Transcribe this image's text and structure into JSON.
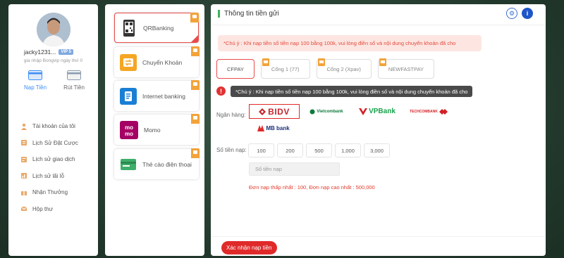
{
  "user": {
    "username": "jacky1231...",
    "vip_badge": "VIP 5",
    "join_line": "gia nhập Bongvip ngày thứ 0"
  },
  "actions": [
    {
      "label": "Nạp Tiền",
      "icon": "deposit-card-icon",
      "active": true
    },
    {
      "label": "Rút Tiền",
      "icon": "withdraw-card-icon",
      "active": false
    }
  ],
  "menu": [
    {
      "label": "Tài khoản của tôi",
      "icon": "account-icon"
    },
    {
      "label": "Lịch Sử Đặt Cược",
      "icon": "bet-history-icon"
    },
    {
      "label": "Lịch sử giao dịch",
      "icon": "transaction-history-icon"
    },
    {
      "label": "Lịch sử lãi lỗ",
      "icon": "profit-loss-icon"
    },
    {
      "label": "Nhận Thưởng",
      "icon": "reward-icon"
    },
    {
      "label": "Hộp thư",
      "icon": "mailbox-icon"
    }
  ],
  "methods": [
    {
      "label": "QRBanking",
      "icon": "qr-icon",
      "active": true
    },
    {
      "label": "Chuyển Khoản",
      "icon": "transfer-icon",
      "active": false
    },
    {
      "label": "Internet banking",
      "icon": "internet-banking-icon",
      "active": false
    },
    {
      "label": "Momo",
      "icon": "momo-icon",
      "active": false
    },
    {
      "label": "Thẻ cào điện thoại",
      "icon": "phone-card-icon",
      "active": false
    }
  ],
  "main": {
    "title": "Thông tin tiền gửi",
    "notice": "*Chú ý : Khi nạp tiền số tiền nạp 100 bằng 100k, vui lòng điền số và nội dung chuyển khoản đã cho",
    "tooltip": "*Chú ý : Khi nạp tiền số tiền nạp 100 bằng 100k, vui lòng điền số và nội dung chuyển khoản đã cho",
    "warn_glyph": "!",
    "channels": [
      "CFPAY",
      "Cổng 1 (77)",
      "Cổng 2 (Xpav)",
      "NEWFASTPAY"
    ],
    "bank_label": "Ngân hàng:",
    "banks": [
      "BIDV",
      "Vietcombank",
      "VPBank",
      "TECHCOMBANK",
      "MB bank"
    ],
    "amount_label": "Số tiền nạp:",
    "amounts": [
      "100",
      "200",
      "500",
      "1,000",
      "3,000"
    ],
    "amount_placeholder": "Số tiền nạp",
    "limits": "Đơn nạp thấp nhất : 100,  Đơn nạp cao nhất : 500,000",
    "submit_label": "Xác nhận nạp tiền"
  },
  "colors": {
    "accent_red": "#e02a2a",
    "active_blue": "#3d8df5",
    "flag_orange": "#f3a33a",
    "background": "#2a3f33"
  }
}
